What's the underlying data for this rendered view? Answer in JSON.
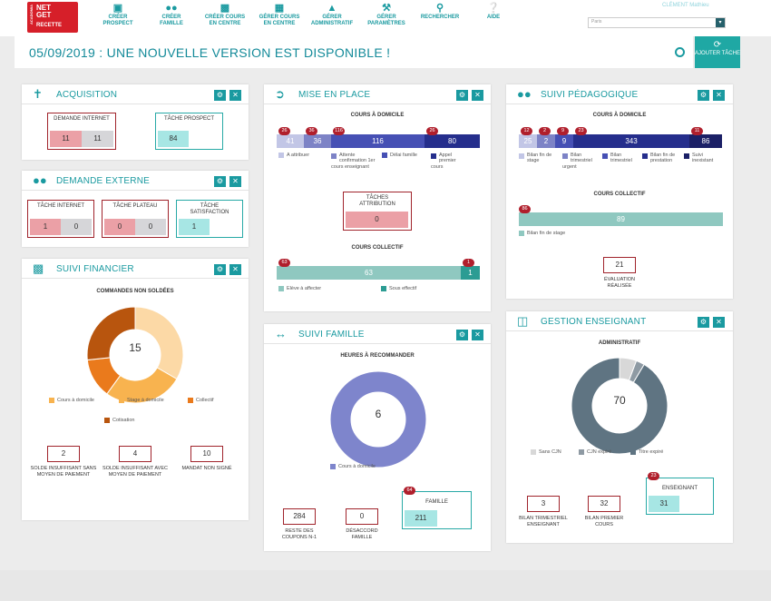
{
  "header": {
    "logo": {
      "side": "ACADOMIA",
      "line1": "NET",
      "line2": "GET",
      "line3": "RECETTE"
    },
    "nav": [
      {
        "label": "CRÉER PROSPECT",
        "icon": "clipboard-icon"
      },
      {
        "label": "CRÉER FAMILLE",
        "icon": "group-add-icon"
      },
      {
        "label": "CRÉER COURS EN CENTRE",
        "icon": "briefcase-icon"
      },
      {
        "label": "GÉRER COURS EN CENTRE",
        "icon": "calendar-icon"
      },
      {
        "label": "GÉRER ADMINISTRATIF",
        "icon": "compass-icon"
      },
      {
        "label": "GÉRER PARAMÈTRES",
        "icon": "wrench-icon"
      },
      {
        "label": "RECHERCHER",
        "icon": "search-icon"
      },
      {
        "label": "AIDE",
        "icon": "help-icon"
      }
    ],
    "user": "CLÉMENT Mathieu",
    "select_value": "Paris"
  },
  "banner": {
    "text": "05/09/2019 : UNE NOUVELLE VERSION EST DISPONIBLE !",
    "add_label": "AJOUTER TÂCHE"
  },
  "acquisition": {
    "title": "ACQUISITION",
    "demande_internet": {
      "label": "DEMANDE INTERNET",
      "v1": "11",
      "v2": "11"
    },
    "tache_prospect": {
      "label": "TÂCHE PROSPECT",
      "v": "84"
    }
  },
  "demande_externe": {
    "title": "DEMANDE EXTERNE",
    "internet": {
      "label": "TÂCHE INTERNET",
      "v1": "1",
      "v2": "0"
    },
    "plateau": {
      "label": "TÂCHE PLATEAU",
      "v1": "0",
      "v2": "0"
    },
    "satisfaction": {
      "label": "TÂCHE SATISFACTION",
      "v": "1"
    }
  },
  "suivi_financier": {
    "title": "SUIVI FINANCIER",
    "subtitle": "COMMANDES NON SOLDÉES",
    "total": "15",
    "legend": [
      "Cours à domicile",
      "Stage à domicile",
      "Collectif",
      "Cotisation"
    ],
    "kpis": [
      {
        "value": "2",
        "caption": "SOLDE INSUFFISANT SANS MOYEN DE PAIEMENT"
      },
      {
        "value": "4",
        "caption": "SOLDE INSUFFISANT AVEC MOYEN DE PAIEMENT"
      },
      {
        "value": "10",
        "caption": "MANDAT NON SIGNÉ"
      }
    ]
  },
  "mise_en_place": {
    "title": "MISE EN PLACE",
    "sub1": "COURS À DOMICILE",
    "bars1": [
      {
        "value": "41",
        "badge": "26"
      },
      {
        "value": "36",
        "badge": "36"
      },
      {
        "value": "116",
        "badge": "116"
      },
      {
        "value": "80",
        "badge": "26"
      }
    ],
    "legend1": [
      "A attribuer",
      "Attente confirmation 1er cours enseignant",
      "Délai famille",
      "Appel premier cours"
    ],
    "taches": {
      "label": "TÂCHES ATTRIBUTION",
      "v": "0"
    },
    "sub2": "COURS COLLECTIF",
    "bars2": [
      {
        "value": "63",
        "badge": "63"
      },
      {
        "value": "1",
        "badge": "1"
      }
    ],
    "legend2": [
      "Elève à affecter",
      "Sous effectif"
    ]
  },
  "suivi_famille": {
    "title": "SUIVI FAMILLE",
    "subtitle": "HEURES À RECOMMANDER",
    "total": "6",
    "legend": [
      "Cours à domicile"
    ],
    "kpis": [
      {
        "value": "284",
        "caption": "RESTE DES COUPONS N-1"
      },
      {
        "value": "0",
        "caption": "DÉSACCORD FAMILLE"
      }
    ],
    "famille": {
      "label": "FAMILLE",
      "v": "211",
      "badge": "64"
    }
  },
  "suivi_pedagogique": {
    "title": "SUIVI PÉDAGOGIQUE",
    "sub1": "COURS À DOMICILE",
    "bars1": [
      {
        "value": "25",
        "badge": "12"
      },
      {
        "value": "2",
        "badge": "2"
      },
      {
        "value": "9",
        "badge": "9"
      },
      {
        "value": "343",
        "badge": "23"
      },
      {
        "value": "86",
        "badge": "11"
      }
    ],
    "legend1": [
      "Bilan fin de stage",
      "Bilan trimestriel urgent",
      "Bilan trimestriel",
      "Bilan fin de prestation",
      "Suivi inexistant"
    ],
    "sub2": "COURS COLLECTIF",
    "bar2": {
      "value": "89",
      "badge": "86"
    },
    "legend2": [
      "Bilan fin de stage"
    ],
    "kpi": {
      "value": "21",
      "caption": "ÉVALUATION RÉALISÉE"
    }
  },
  "gestion_enseignant": {
    "title": "GESTION ENSEIGNANT",
    "subtitle": "ADMINISTRATIF",
    "total": "70",
    "legend": [
      "Sans CJN",
      "CJN expiré",
      "Titre expiré"
    ],
    "kpis": [
      {
        "value": "3",
        "caption": "BILAN TRIMESTRIEL ENSEIGNANT"
      },
      {
        "value": "32",
        "caption": "BILAN PREMIER COURS"
      }
    ],
    "enseignant": {
      "label": "ENSEIGNANT",
      "v": "31",
      "badge": "23"
    }
  },
  "chart_data": [
    {
      "type": "pie",
      "categories": [
        "Cours à domicile",
        "Stage à domicile",
        "Collectif",
        "Cotisation"
      ],
      "values": [
        5,
        4,
        2,
        4
      ],
      "colors": [
        "#fcd9a6",
        "#f8b34f",
        "#ea7a1c",
        "#b8550e"
      ]
    },
    {
      "type": "pie",
      "categories": [
        "Cours à domicile"
      ],
      "values": [
        6
      ],
      "colors": [
        "#7e85cc"
      ]
    },
    {
      "type": "pie",
      "categories": [
        "Sans CJN",
        "CJN expiré",
        "Titre expiré"
      ],
      "values": [
        4,
        2,
        64
      ],
      "colors": [
        "#d8d8d8",
        "#8e9aa3",
        "#5f7482"
      ]
    }
  ]
}
